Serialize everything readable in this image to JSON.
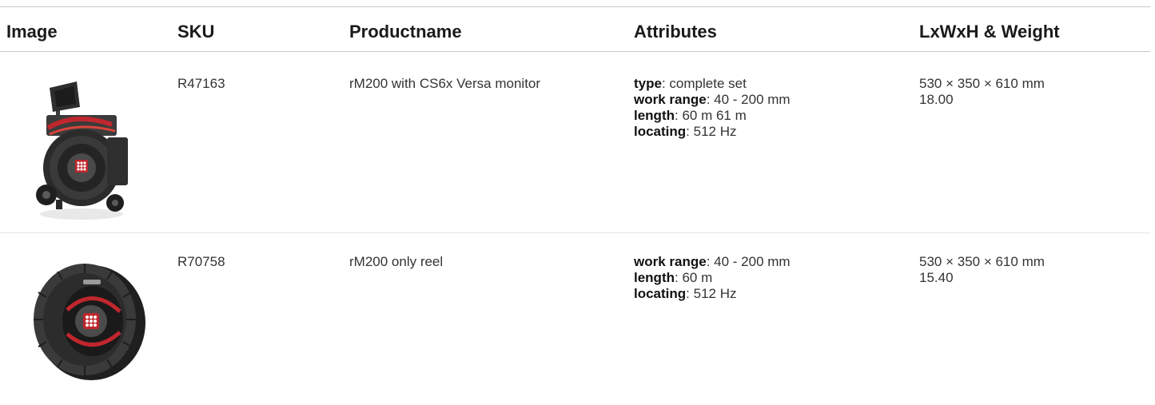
{
  "table": {
    "headers": {
      "image": "Image",
      "sku": "SKU",
      "productname": "Productname",
      "attributes": "Attributes",
      "dims": "LxWxH & Weight"
    },
    "rows": [
      {
        "image_icon": "pipe-inspection-reel-with-monitor-image",
        "sku": "R47163",
        "productname": "rM200 with CS6x Versa monitor",
        "attributes": [
          {
            "key": "type",
            "value": ": complete set"
          },
          {
            "key": "work range",
            "value": ": 40 - 200 mm"
          },
          {
            "key": "length",
            "value": ": 60 m 61 m"
          },
          {
            "key": "locating",
            "value": ": 512 Hz"
          }
        ],
        "dimensions": "530 × 350 × 610 mm",
        "weight": "18.00"
      },
      {
        "image_icon": "pipe-inspection-reel-image",
        "sku": "R70758",
        "productname": "rM200 only reel",
        "attributes": [
          {
            "key": "work range",
            "value": ": 40 - 200 mm"
          },
          {
            "key": "length",
            "value": ": 60 m"
          },
          {
            "key": "locating",
            "value": ": 512 Hz"
          }
        ],
        "dimensions": "530 × 350 × 610 mm",
        "weight": "15.40"
      }
    ]
  },
  "colors": {
    "text": "#333333",
    "header_text": "#1a1a1a",
    "rule": "#c8c8c8",
    "reel_dark": "#2b2b2b",
    "accent_red": "#c0262d"
  }
}
